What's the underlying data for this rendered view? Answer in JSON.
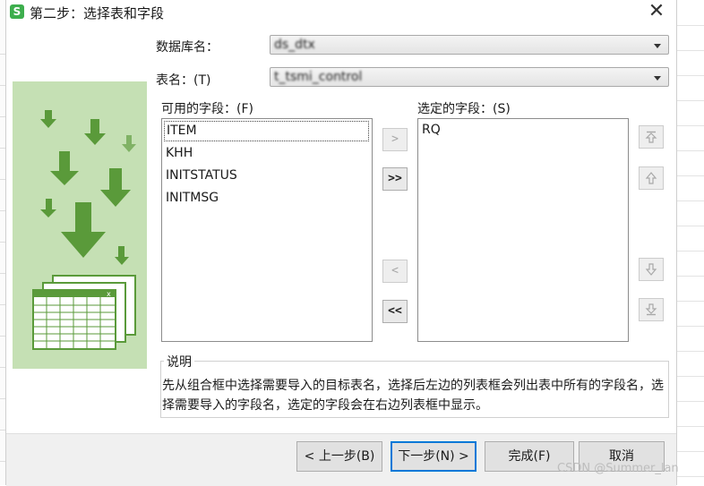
{
  "dialog": {
    "title": "第二步：选择表和字段",
    "close_glyph": "✕"
  },
  "database": {
    "label": "数据库名：",
    "value": "ds_dtx"
  },
  "table": {
    "label": "表名：(T)",
    "value": "t_tsmi_control"
  },
  "available_fields": {
    "label": "可用的字段：(F)",
    "items": [
      "ITEM",
      "KHH",
      "INITSTATUS",
      "INITMSG"
    ]
  },
  "selected_fields": {
    "label": "选定的字段：(S)",
    "items": [
      "RQ"
    ]
  },
  "move_buttons": {
    "add_one": ">",
    "add_all": ">>",
    "remove_one": "<",
    "remove_all": "<<"
  },
  "description": {
    "title": "说明",
    "text": "先从组合框中选择需要导入的目标表名，选择后左边的列表框会列出表中所有的字段名，选择需要导入的字段名，选定的字段会在右边列表框中显示。"
  },
  "footer": {
    "prev": "< 上一步(B)",
    "next": "下一步(N) >",
    "finish": "完成(F)",
    "cancel": "取消"
  },
  "watermark": "CSDN @Summer_lan",
  "colors": {
    "illustration_bg": "#c5e0b4",
    "arrow_green": "#5a9a3a",
    "default_button_border": "#0078d7"
  }
}
